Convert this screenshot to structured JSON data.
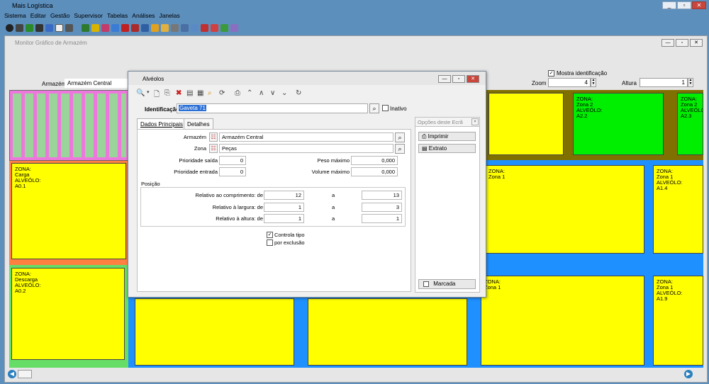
{
  "app": {
    "title": "Mais Logística"
  },
  "menu": [
    "Sistema",
    "Editar",
    "Gestão",
    "Supervisor",
    "Tabelas",
    "Análises",
    "Janelas"
  ],
  "inner_window": {
    "title": "Monitor Gráfico de Armazém",
    "armazem_label": "Armazém",
    "armazem_value": "Armazém Central",
    "show_id_label": "Mostra identificação",
    "zoom_label": "Zoom",
    "zoom_value": "4",
    "altura_label": "Altura",
    "altura_value": "1"
  },
  "slots": [
    {
      "lines": [
        "ZONA:",
        "Carga",
        "ALVEÓLO:",
        "A0.1"
      ]
    },
    {
      "lines": [
        "ZONA:",
        "Descarga",
        "ALVEÓLO:",
        "A0.2"
      ]
    },
    {
      "lines": [
        "ZONA:",
        "Zona 2",
        "ALVEÓLO:",
        "A2.2"
      ]
    },
    {
      "lines": [
        "ZONA:",
        "Zona 2",
        "ALVEÓLO:",
        "A2.3"
      ]
    },
    {
      "lines": [
        "ZONA:",
        "Zona 1",
        "ALVEÓLO:",
        "A1.4"
      ]
    },
    {
      "lines": [
        "ZONA:",
        "Zona 1",
        "ALVEÓLO:",
        "A1.9"
      ]
    },
    {
      "lines": [
        "ZONA:",
        "Zona 1"
      ]
    },
    {
      "lines": [
        "ZONA:",
        "Zona 1"
      ]
    }
  ],
  "dialog": {
    "title": "Alvéolos",
    "identificacao_label": "Identificação",
    "identificacao_value": "Gaveta 71",
    "inativo_label": "Inativo",
    "tab_dados": "Dados Principais",
    "tab_detalhes": "Detalhes",
    "armazem_label": "Armazém",
    "armazem_value": "Armazém Central",
    "zona_label": "Zona",
    "zona_value": "Peças",
    "prio_saida_label": "Prioridade saída",
    "prio_saida_value": "0",
    "prio_entrada_label": "Prioridade  entrada",
    "prio_entrada_value": "0",
    "peso_label": "Peso máximo",
    "peso_value": "0,000",
    "volume_label": "Volume máximo",
    "volume_value": "0,000",
    "posicao_label": "Posição",
    "rel_comp_label": "Relativo ao comprimento: de",
    "rel_comp_de": "12",
    "rel_comp_a": "13",
    "rel_larg_label": "Relativo à largura: de",
    "rel_larg_de": "1",
    "rel_larg_a": "3",
    "rel_alt_label": "Relativo à altura: de",
    "rel_alt_de": "1",
    "rel_alt_a": "1",
    "a_label": "a",
    "controla_tipo_label": "Controla tipo",
    "por_exclusao_label": "por exclusão",
    "opcoes_label": "Opções deste Ecrã",
    "imprimir_label": "Imprimir",
    "extrato_label": "Extrato",
    "marcada_label": "Marcada"
  }
}
